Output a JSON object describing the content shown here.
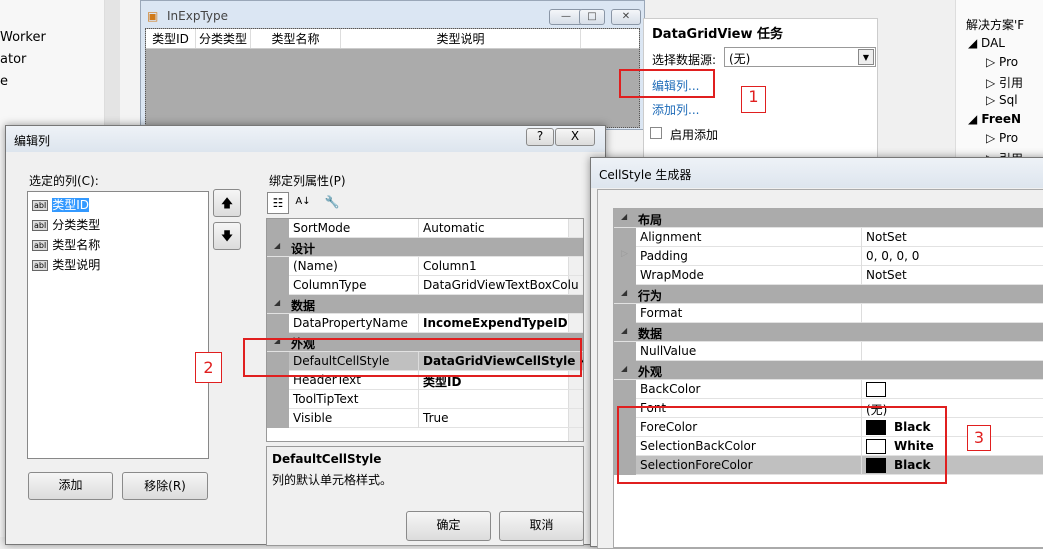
{
  "background": {
    "left_items": [
      "Worker",
      "ator",
      "e"
    ]
  },
  "form": {
    "title": "InExpType",
    "columns": [
      "类型ID",
      "分类类型",
      "类型名称",
      "类型说明"
    ]
  },
  "tasks": {
    "title": "DataGridView 任务",
    "datasource_label": "选择数据源:",
    "datasource_value": "(无)",
    "edit_columns": "编辑列...",
    "add_column": "添加列...",
    "enable_add": "启用添加"
  },
  "solution": {
    "items": [
      "解决方案'F",
      "DAL",
      "Pro",
      "引用",
      "Sql",
      "FreeN",
      "Pro",
      "引用"
    ]
  },
  "annotations": {
    "one": "1",
    "two": "2",
    "three": "3",
    "color": "#e01f1f"
  },
  "edit_dialog": {
    "title": "编辑列",
    "help": "?",
    "close": "X",
    "selected_label": "选定的列(C):",
    "columns": [
      "类型ID",
      "分类类型",
      "类型名称",
      "类型说明"
    ],
    "selected_index": 0,
    "add": "添加",
    "remove": "移除(R)",
    "props_label": "绑定列属性(P)",
    "properties": [
      {
        "name": "SortMode",
        "value": "Automatic"
      },
      {
        "cat": "设计"
      },
      {
        "name": "(Name)",
        "value": "Column1"
      },
      {
        "name": "ColumnType",
        "value": "DataGridViewTextBoxColu"
      },
      {
        "cat": "数据"
      },
      {
        "name": "DataPropertyName",
        "value": "IncomeExpendTypeID",
        "bold": true
      },
      {
        "cat": "外观"
      },
      {
        "name": "DefaultCellStyle",
        "value": "DataGridViewCellStyle {",
        "bold": true,
        "selected": true
      },
      {
        "name": "HeaderText",
        "value": "类型ID",
        "bold": true
      },
      {
        "name": "ToolTipText",
        "value": ""
      },
      {
        "name": "Visible",
        "value": "True"
      }
    ],
    "desc_title": "DefaultCellStyle",
    "desc_text": "列的默认单元格样式。",
    "ok": "确定",
    "cancel": "取消"
  },
  "cellstyle_dialog": {
    "title": "CellStyle 生成器",
    "properties": [
      {
        "cat": "布局"
      },
      {
        "name": "Alignment",
        "value": "NotSet"
      },
      {
        "name": "Padding",
        "value": "0, 0, 0, 0",
        "expand": true
      },
      {
        "name": "WrapMode",
        "value": "NotSet"
      },
      {
        "cat": "行为"
      },
      {
        "name": "Format",
        "value": ""
      },
      {
        "cat": "数据"
      },
      {
        "name": "NullValue",
        "value": ""
      },
      {
        "cat": "外观"
      },
      {
        "name": "BackColor",
        "value": "",
        "swatch": "#ffffff"
      },
      {
        "name": "Font",
        "value": "(无)"
      },
      {
        "name": "ForeColor",
        "value": "Black",
        "swatch": "#000000",
        "bold": true
      },
      {
        "name": "SelectionBackColor",
        "value": "White",
        "swatch": "#ffffff",
        "bold": true
      },
      {
        "name": "SelectionForeColor",
        "value": "Black",
        "swatch": "#000000",
        "bold": true,
        "selected": true
      }
    ]
  }
}
